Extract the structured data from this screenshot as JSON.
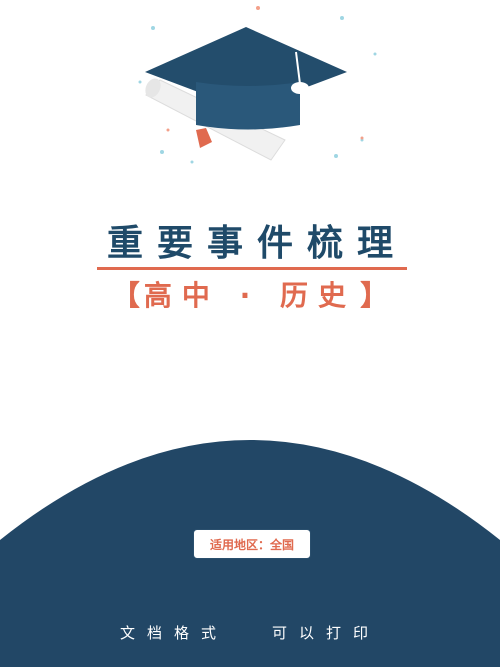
{
  "header": {
    "title": "重要事件梳理",
    "subtitle_open": "【",
    "subtitle": "高中 · 历史",
    "subtitle_close": "】"
  },
  "badge": {
    "label": "适用地区：全国"
  },
  "footer": {
    "left": "文档格式",
    "right": "可以打印"
  },
  "colors": {
    "navy": "#1f4a69",
    "accent": "#e06a4f",
    "white": "#ffffff"
  },
  "icons": [
    "graduation-cap-icon",
    "diploma-scroll-icon"
  ]
}
